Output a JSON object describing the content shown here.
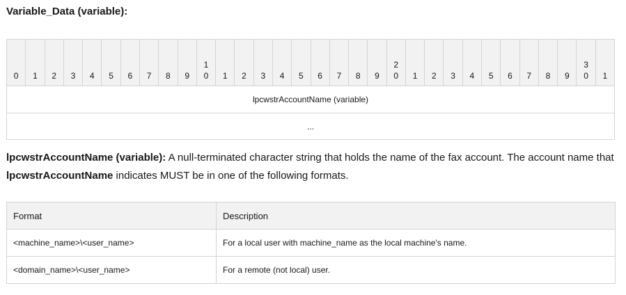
{
  "section_title": "Variable_Data (variable):",
  "bit_ruler": {
    "tens": [
      "",
      "",
      "",
      "",
      "",
      "",
      "",
      "",
      "",
      "",
      "1",
      "",
      "",
      "",
      "",
      "",
      "",
      "",
      "",
      "",
      "2",
      "",
      "",
      "",
      "",
      "",
      "",
      "",
      "",
      "",
      "3",
      ""
    ],
    "units": [
      "0",
      "1",
      "2",
      "3",
      "4",
      "5",
      "6",
      "7",
      "8",
      "9",
      "0",
      "1",
      "2",
      "3",
      "4",
      "5",
      "6",
      "7",
      "8",
      "9",
      "0",
      "1",
      "2",
      "3",
      "4",
      "5",
      "6",
      "7",
      "8",
      "9",
      "0",
      "1"
    ]
  },
  "bit_fields": {
    "row1": "lpcwstrAccountName (variable)",
    "row2": "..."
  },
  "paragraph": {
    "term": "lpcwstrAccountName (variable):",
    "text1": " A null-terminated character string that holds the name of the fax account. The account name that ",
    "term2": "lpcwstrAccountName",
    "text2": " indicates MUST be in one of the following formats."
  },
  "format_table": {
    "headers": [
      "Format",
      "Description"
    ],
    "rows": [
      [
        "<machine_name>\\<user_name>",
        "For a local user with machine_name as the local machine's name."
      ],
      [
        "<domain_name>\\<user_name>",
        "For a remote (not local) user."
      ]
    ]
  }
}
